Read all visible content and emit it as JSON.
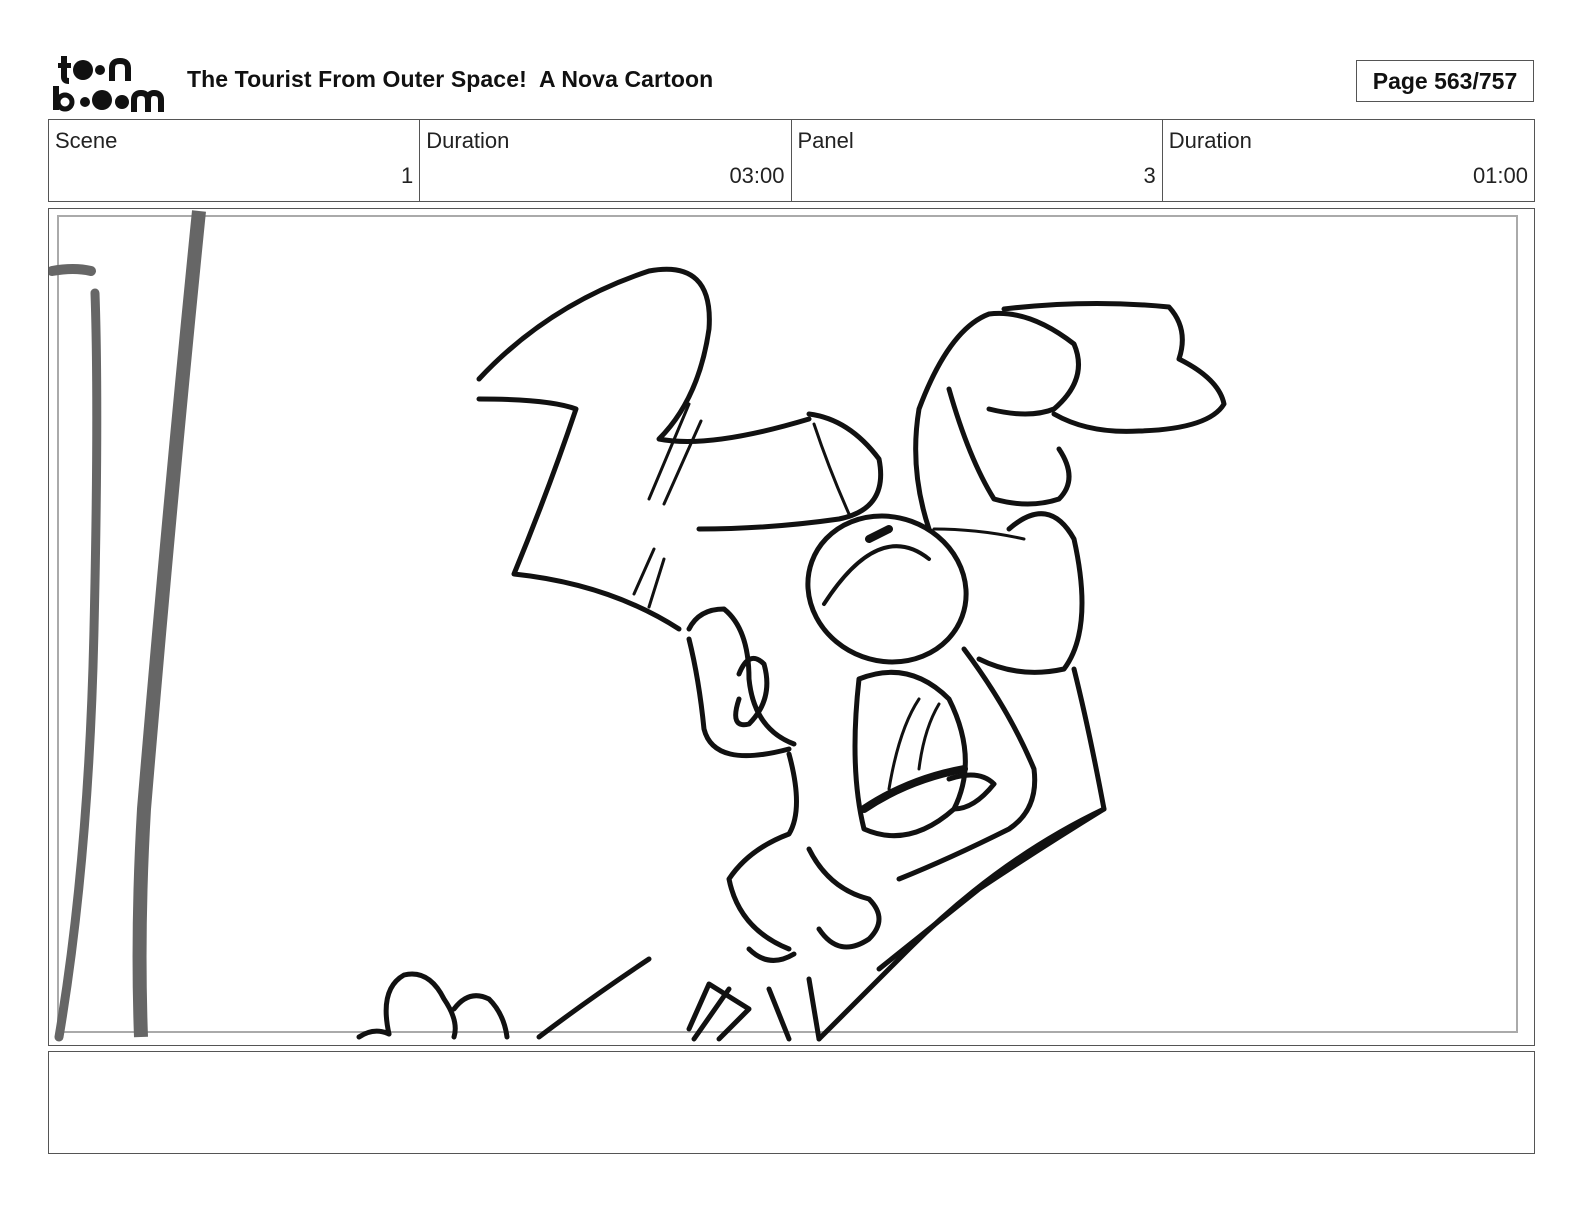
{
  "header": {
    "logo_text_top": "toon",
    "logo_text_bottom": "boom",
    "title": "The Tourist From Outer Space!  A Nova Cartoon",
    "page_label": "Page 563/757"
  },
  "info": {
    "scene_label": "Scene",
    "scene_value": "1",
    "scene_duration_label": "Duration",
    "scene_duration_value": "03:00",
    "panel_label": "Panel",
    "panel_value": "3",
    "panel_duration_label": "Duration",
    "panel_duration_value": "01:00"
  },
  "panel": {
    "image_subject": "character-sketch"
  },
  "notes": {
    "text": ""
  }
}
